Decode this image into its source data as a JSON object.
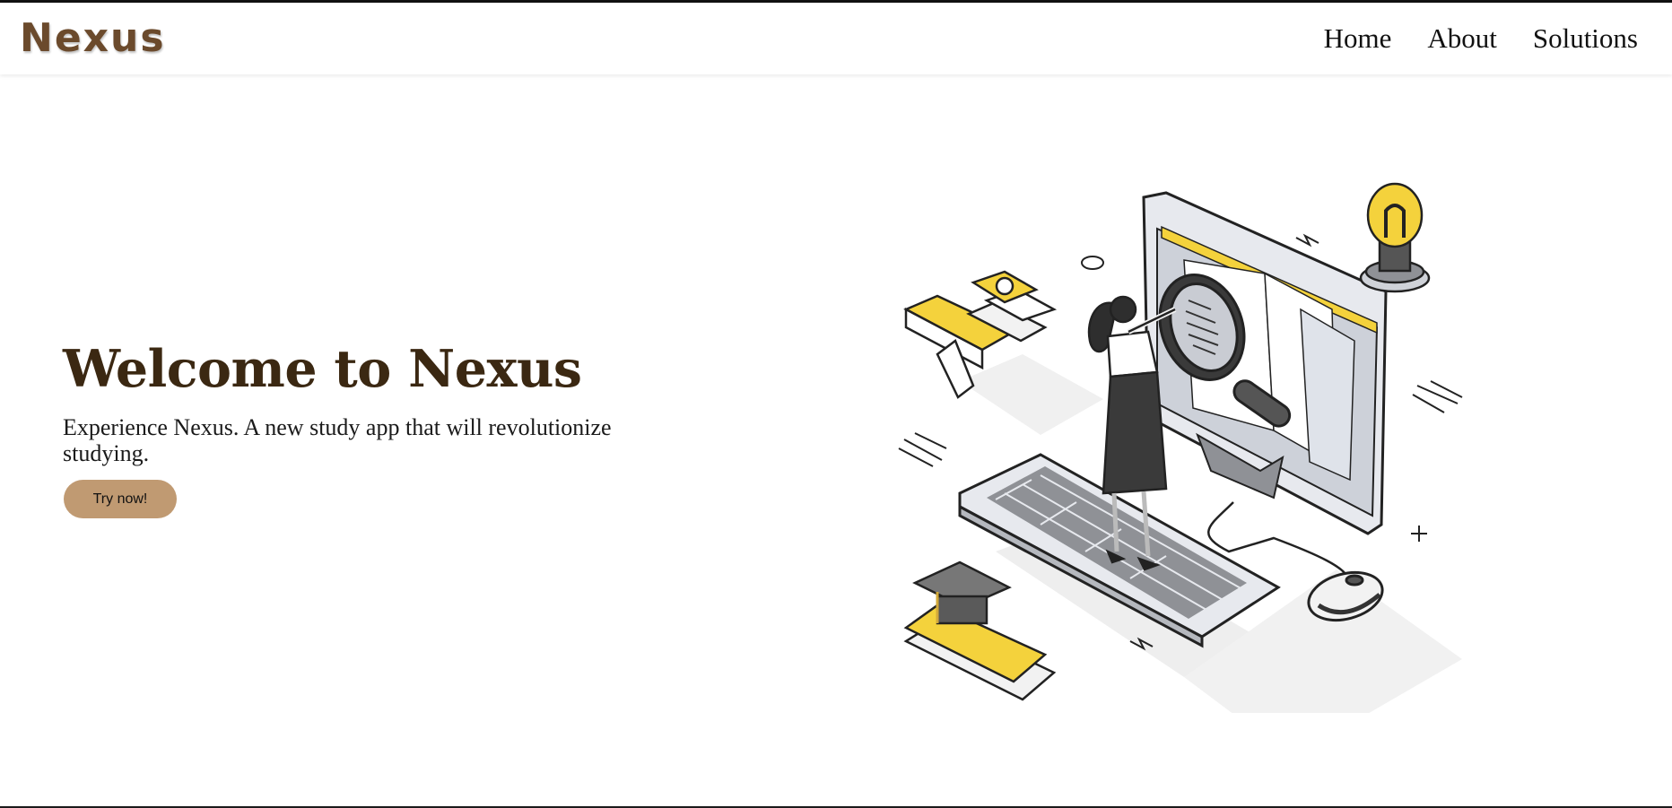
{
  "header": {
    "logo": "Nexus",
    "nav": [
      {
        "label": "Home"
      },
      {
        "label": "About"
      },
      {
        "label": "Solutions"
      }
    ]
  },
  "hero": {
    "title": "Welcome to Nexus",
    "subtitle": "Experience Nexus. A new study app that will revolutionize studying.",
    "cta_label": "Try now!"
  },
  "colors": {
    "logo": "#6b4a2c",
    "title": "#3b2812",
    "button": "#c09a72",
    "accent_yellow": "#f4d23c"
  },
  "illustration": {
    "icon": "study-isometric-illustration"
  }
}
